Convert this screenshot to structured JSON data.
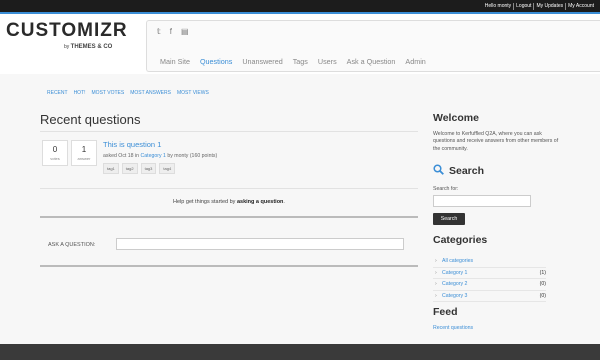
{
  "userbar": {
    "greeting": "Hello monty",
    "logout": "Logout",
    "updates": "My Updates",
    "account": "My Account"
  },
  "logo": {
    "text": "CUSTOMIZR",
    "by": "by",
    "brand": "THEMES & CO"
  },
  "social": {
    "twitter": "𝕥",
    "facebook": "f",
    "rss": "▤"
  },
  "nav": [
    "Main Site",
    "Questions",
    "Unanswered",
    "Tags",
    "Users",
    "Ask a Question",
    "Admin"
  ],
  "nav_active": "Questions",
  "subnav": [
    "RECENT",
    "HOT!",
    "MOST VOTES",
    "MOST ANSWERS",
    "MOST VIEWS"
  ],
  "main": {
    "title": "Recent questions",
    "question": {
      "votes": "0",
      "votes_label": "votes",
      "answers": "1",
      "answers_label": "answer",
      "title": "This is question 1",
      "meta_prefix": "asked Oct 18 in",
      "category": "Category 1",
      "meta_suffix": "by monty (160 points)",
      "tags": [
        "tag1",
        "tag2",
        "tag3",
        "tag4"
      ]
    },
    "help_prefix": "Help get things started by",
    "help_link": "asking a question",
    "help_suffix": ".",
    "ask_label": "ASK A QUESTION:"
  },
  "sidebar": {
    "welcome_title": "Welcome",
    "welcome_text": "Welcome to Kerfuffled Q2A, where you can ask questions and receive answers from other members of the community.",
    "search_title": "Search",
    "search_for": "Search for:",
    "search_button": "Search",
    "categories_title": "Categories",
    "categories": [
      {
        "name": "All categories",
        "count": ""
      },
      {
        "name": "Category 1",
        "count": "(1)"
      },
      {
        "name": "Category 2",
        "count": "(0)"
      },
      {
        "name": "Category 3",
        "count": "(0)"
      }
    ],
    "feed_title": "Feed",
    "feed_link": "Recent questions"
  },
  "colors": {
    "accent": "#3b8ed6",
    "topbar": "#1c1c1c",
    "footer": "#3a3a3a"
  }
}
